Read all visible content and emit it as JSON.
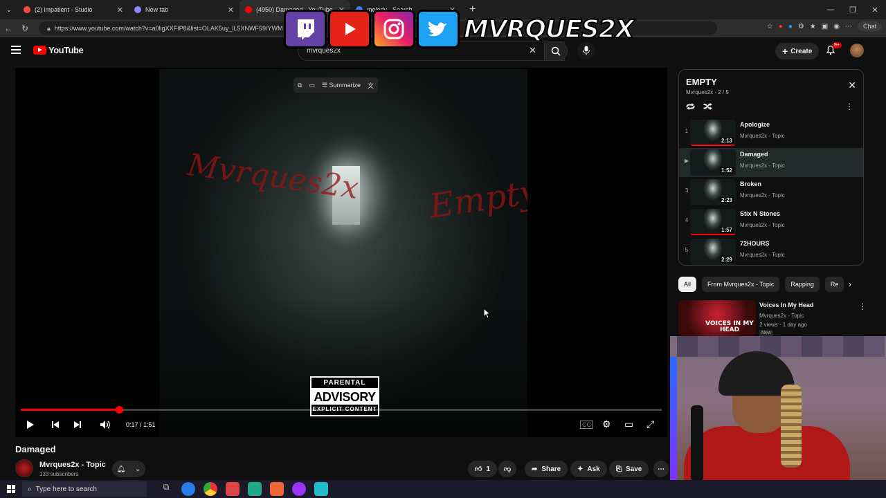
{
  "browser": {
    "tabs": [
      {
        "label": "(2) impatient - Studio",
        "color": "#ff4444"
      },
      {
        "label": "New tab",
        "color": "#8888ff"
      },
      {
        "label": "(4950) Damaged - YouTube",
        "color": "#ff0000"
      },
      {
        "label": "melody - Search",
        "color": "#3b82f6"
      }
    ],
    "url": "https://www.youtube.com/watch?v=a0ligXXFIP8&list=OLAK5uy_lL5XNWF59/YWM",
    "chat_label": "Chat"
  },
  "youtube": {
    "logo_text": "YouTube",
    "search_value": "mvrques2x",
    "create_label": "Create",
    "notif_badge": "9+"
  },
  "overlay": {
    "handle": "MVRQUES2X"
  },
  "player": {
    "summarize_label": "Summarize",
    "time": "0:17 / 1:51",
    "progress": 0.153,
    "cover_text_left": "Mvrques2x",
    "cover_text_right": "Empty",
    "advisory_line1": "PARENTAL",
    "advisory_line2": "ADVISORY",
    "advisory_line3": "EXPLICIT CONTENT"
  },
  "video": {
    "title": "Damaged",
    "channel": "Mvrques2x - Topic",
    "subscribers": "133 subscribers",
    "likes": "1",
    "share_label": "Share",
    "ask_label": "Ask",
    "save_label": "Save"
  },
  "playlist": {
    "title": "EMPTY",
    "subtitle": "Mvrques2x - 2 / 5",
    "items": [
      {
        "index": "1",
        "title": "Apologize",
        "channel": "Mvrques2x - Topic",
        "duration": "2:13"
      },
      {
        "index": "▶",
        "title": "Damaged",
        "channel": "Mvrques2x - Topic",
        "duration": "1:52"
      },
      {
        "index": "3",
        "title": "Broken",
        "channel": "Mvrques2x - Topic",
        "duration": "2:23"
      },
      {
        "index": "4",
        "title": "Stix N Stones",
        "channel": "Mvrques2x - Topic",
        "duration": "1:57"
      },
      {
        "index": "5",
        "title": "72HOURS",
        "channel": "Mvrques2x - Topic",
        "duration": "2:29"
      }
    ]
  },
  "chips": [
    "All",
    "From Mvrques2x - Topic",
    "Rapping",
    "Re"
  ],
  "recommendation": {
    "title": "Voices In My Head",
    "channel": "Mvrques2x - Topic",
    "meta": "2 views · 1 day ago",
    "badge": "New",
    "thumb_text": "VOICES IN MY HEAD"
  },
  "taskbar": {
    "search_placeholder": "Type here to search"
  }
}
